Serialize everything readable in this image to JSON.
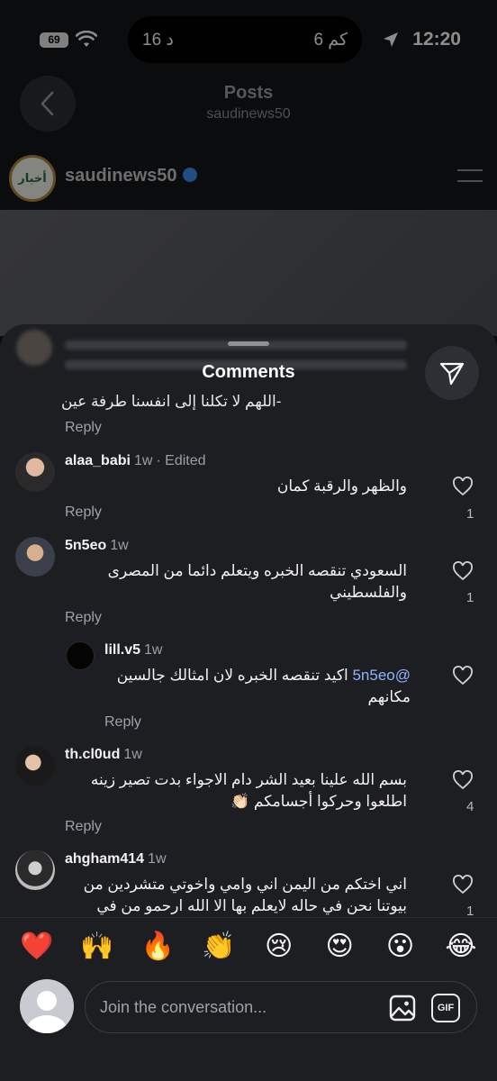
{
  "status_bar": {
    "time": "12:20",
    "battery": "69",
    "island_left": "16 د",
    "island_right": "6 كم"
  },
  "post_header": {
    "title": "Posts",
    "subtitle": "saudinews50",
    "author": "saudinews50",
    "logo_text": "أخبار"
  },
  "comments_sheet": {
    "title": "Comments",
    "previous_comment": {
      "text": "-اللهم لا تكلنا إلى انفسنا طرفة عين",
      "reply_label": "Reply"
    },
    "comments": [
      {
        "username": "alaa_babi",
        "time": "1w",
        "edited": "· Edited",
        "text": "والظهر والرقبة كمان",
        "likes": "1",
        "reply_label": "Reply"
      },
      {
        "username": "5n5eo",
        "time": "1w",
        "text": "السعودي تنقصه الخبره ويتعلم دائما من المصرى والفلسطيني",
        "likes": "1",
        "reply_label": "Reply",
        "replies": [
          {
            "username": "lill.v5",
            "time": "1w",
            "mention": "@5n5eo",
            "text": "اكيد تنقصه الخبره لان امثالك جالسين مكانهم",
            "reply_label": "Reply"
          }
        ]
      },
      {
        "username": "th.cl0ud",
        "time": "1w",
        "text": "بسم الله علينا بعيد الشر دام الاجواء بدت تصير زينه اطلعوا وحركوا أجسامكم 👏🏻",
        "likes": "4",
        "reply_label": "Reply"
      },
      {
        "username": "ahgham414",
        "time": "1w",
        "text": "اني اختكم من اليمن اني وامي واخوتي متشردين من بيوتنا نحن في حاله لايعلم بها الا الله ارحمو من في",
        "likes": "1"
      }
    ]
  },
  "emoji_bar": [
    "❤️",
    "🙌",
    "🔥",
    "👏",
    "😢",
    "😍",
    "😮",
    "😂"
  ],
  "composer": {
    "placeholder": "Join the conversation...",
    "gif_label": "GIF"
  },
  "colors": {
    "sheet_bg": "#1c1e22",
    "mention": "#8fb4ff",
    "verified": "#3a8df0"
  }
}
